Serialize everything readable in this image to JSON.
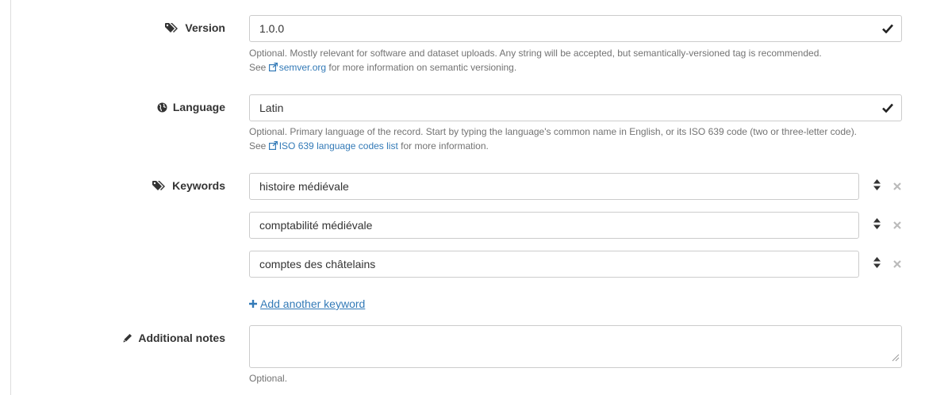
{
  "version": {
    "label": "Version",
    "value": "1.0.0",
    "help_line1": "Optional. Mostly relevant for software and dataset uploads. Any string will be accepted, but semantically-versioned tag is recommended.",
    "help_see": "See",
    "help_link": "semver.org",
    "help_rest": "for more information on semantic versioning."
  },
  "language": {
    "label": "Language",
    "value": "Latin",
    "help_line1": "Optional. Primary language of the record. Start by typing the language's common name in English, or its ISO 639 code (two or three-letter code).",
    "help_see": "See",
    "help_link": "ISO 639 language codes list",
    "help_rest": "for more information."
  },
  "keywords": {
    "label": "Keywords",
    "items": [
      "histoire médiévale",
      "comptabilité médiévale",
      "comptes des châtelains"
    ],
    "add_label": "Add another keyword"
  },
  "notes": {
    "label": "Additional notes",
    "value": "",
    "help": "Optional."
  },
  "icons": {
    "version": "tags-icon",
    "language": "globe-icon",
    "keywords": "tags-icon",
    "notes": "pencil-icon",
    "valid": "checkmark-icon",
    "sort": "sort-icon",
    "remove": "remove-icon",
    "add": "plus-icon",
    "external": "external-link-icon"
  },
  "colors": {
    "link": "#337ab7",
    "help": "#737373",
    "border": "#cccccc"
  }
}
